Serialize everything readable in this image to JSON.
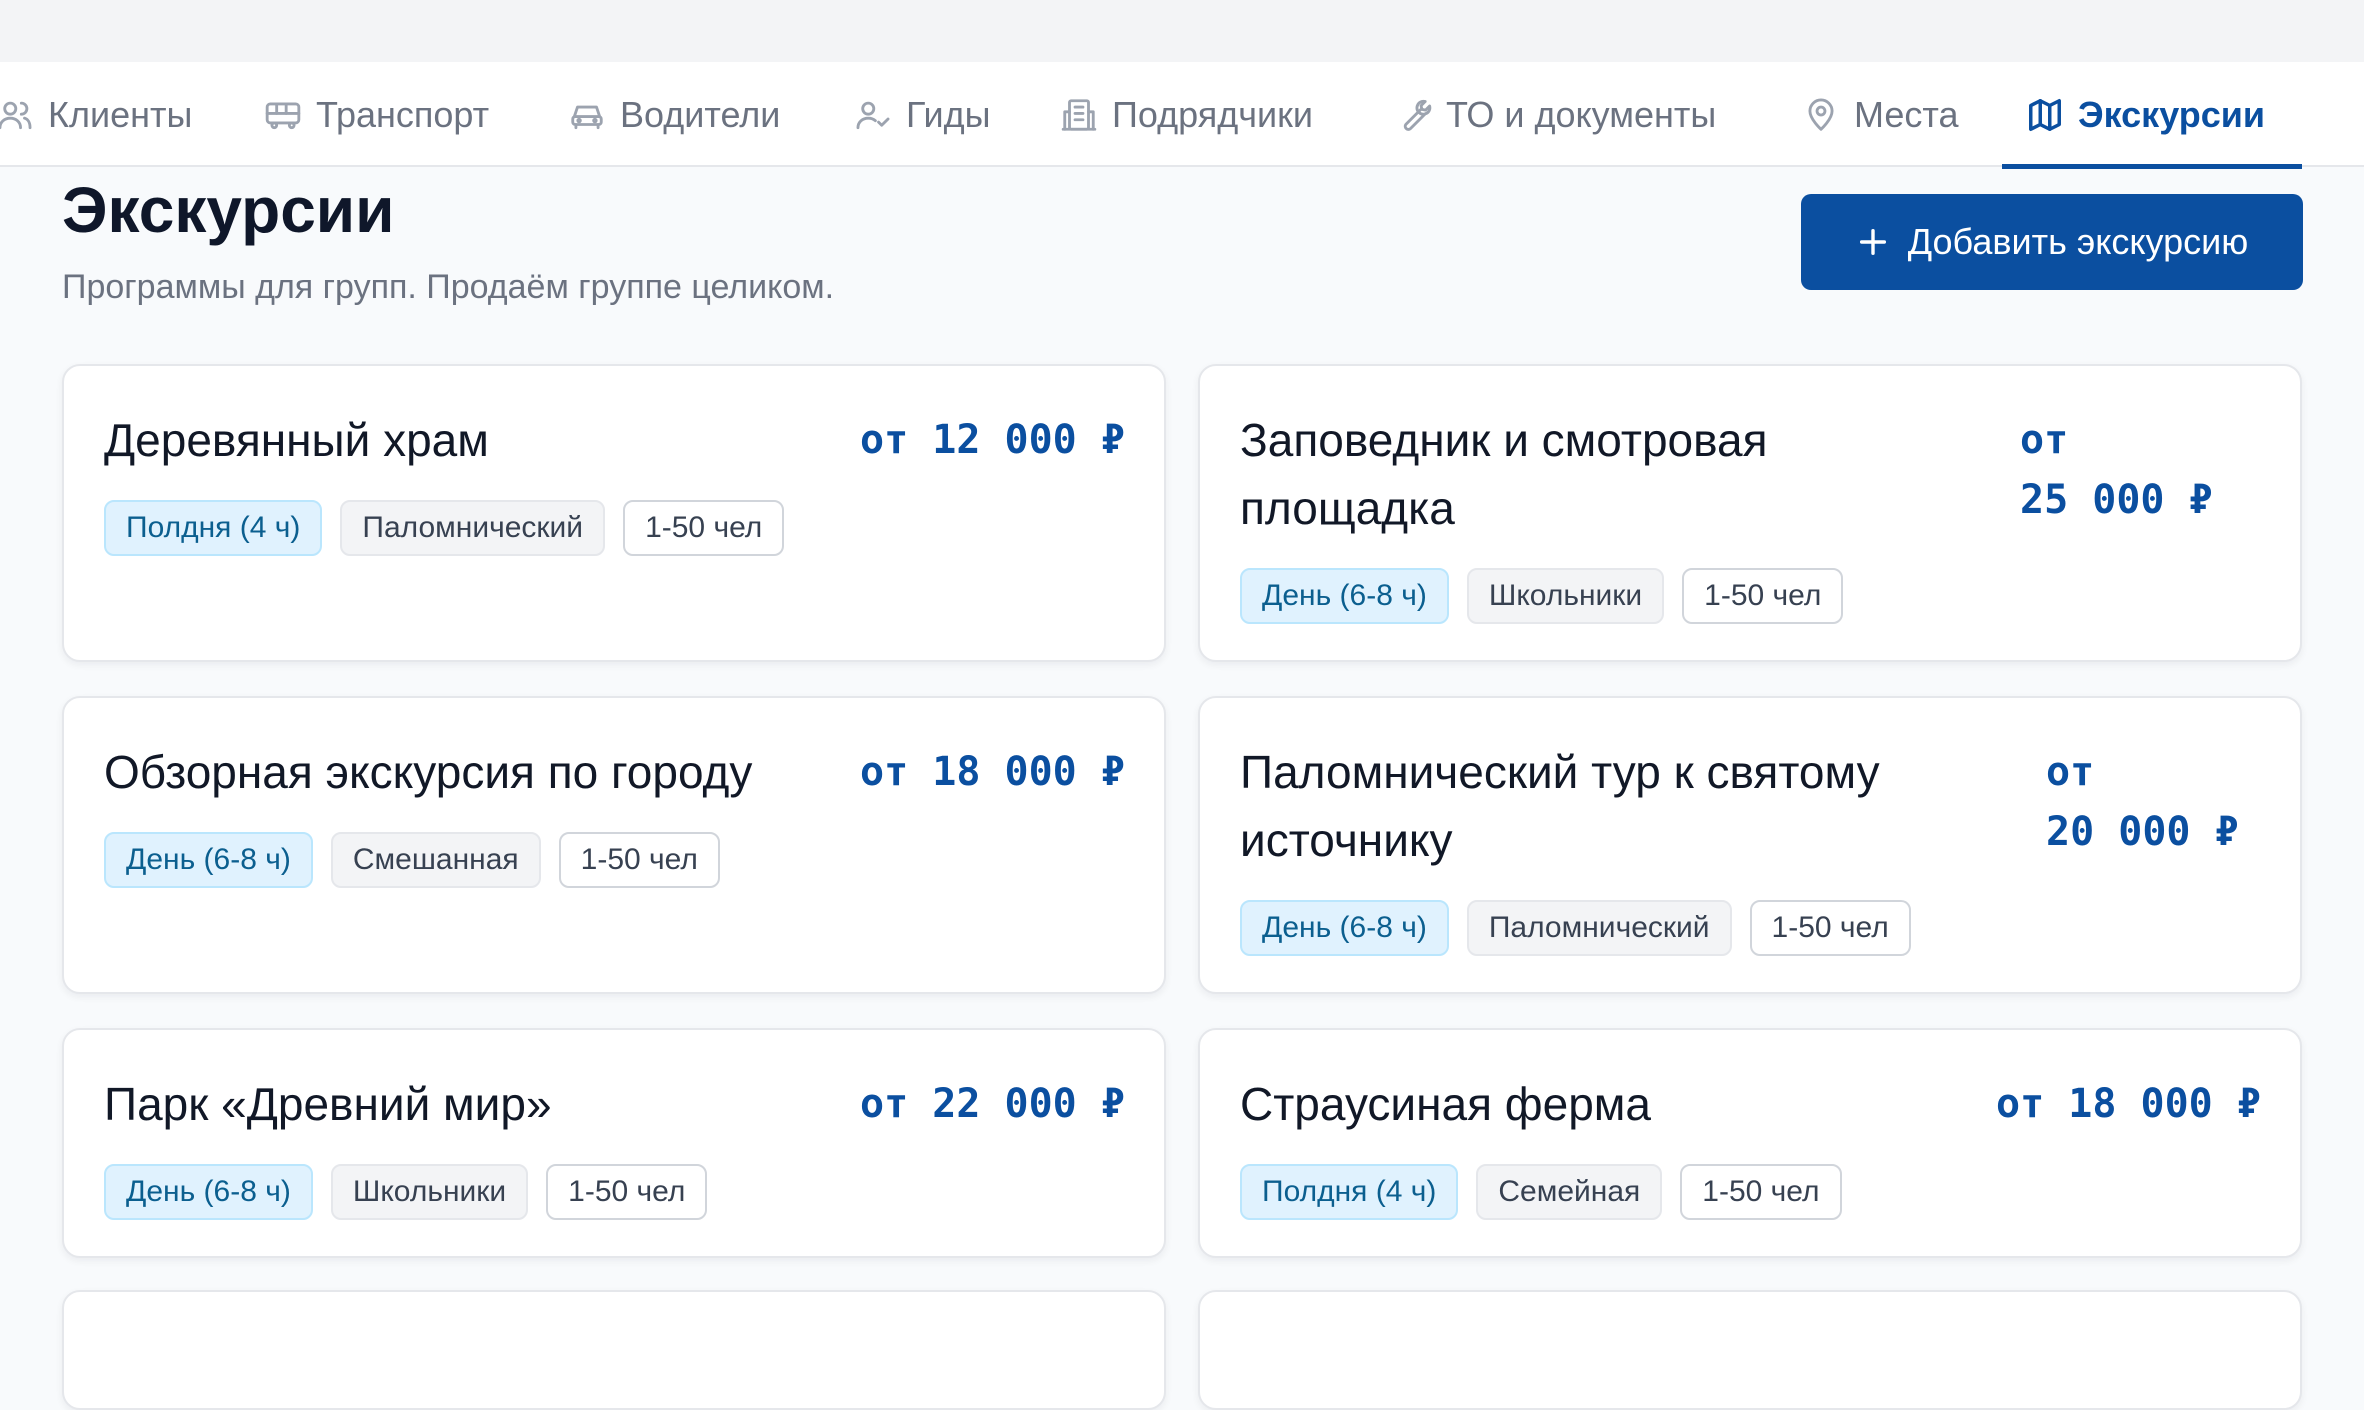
{
  "nav": {
    "items": [
      {
        "label": "Клиенты",
        "icon": "users-icon"
      },
      {
        "label": "Транспорт",
        "icon": "bus-icon"
      },
      {
        "label": "Водители",
        "icon": "car-icon"
      },
      {
        "label": "Гиды",
        "icon": "user-check-icon"
      },
      {
        "label": "Подрядчики",
        "icon": "building-icon"
      },
      {
        "label": "ТО и документы",
        "icon": "wrench-icon"
      },
      {
        "label": "Места",
        "icon": "map-pin-icon"
      },
      {
        "label": "Экскурсии",
        "icon": "map-icon",
        "active": true
      }
    ]
  },
  "header": {
    "title": "Экскурсии",
    "subtitle": "Программы для групп. Продаём группе целиком.",
    "add_button_label": "Добавить экскурсию"
  },
  "cards": [
    {
      "title": "Деревянный храм",
      "price_prefix": "от",
      "price": "12 000 ₽",
      "duration": "Полдня (4 ч)",
      "type": "Паломнический",
      "people": "1-50 чел"
    },
    {
      "title": "Заповедник и смотровая площадка",
      "price_prefix": "от",
      "price": "25 000 ₽",
      "duration": "День (6-8 ч)",
      "type": "Школьники",
      "people": "1-50 чел"
    },
    {
      "title": "Обзорная экскурсия по городу",
      "price_prefix": "от",
      "price": "18 000 ₽",
      "duration": "День (6-8 ч)",
      "type": "Смешанная",
      "people": "1-50 чел"
    },
    {
      "title": "Паломнический тур к святому источнику",
      "price_prefix": "от",
      "price": "20 000 ₽",
      "duration": "День (6-8 ч)",
      "type": "Паломнический",
      "people": "1-50 чел"
    },
    {
      "title": "Парк «Древний мир»",
      "price_prefix": "от",
      "price": "22 000 ₽",
      "duration": "День (6-8 ч)",
      "type": "Школьники",
      "people": "1-50 чел"
    },
    {
      "title": "Страусиная ферма",
      "price_prefix": "от",
      "price": "18 000 ₽",
      "duration": "Полдня (4 ч)",
      "type": "Семейная",
      "people": "1-50 чел"
    }
  ],
  "colors": {
    "accent": "#0b4fa0",
    "duration_tag_bg": "#e0f2fe",
    "type_tag_bg": "#f3f4f6"
  }
}
